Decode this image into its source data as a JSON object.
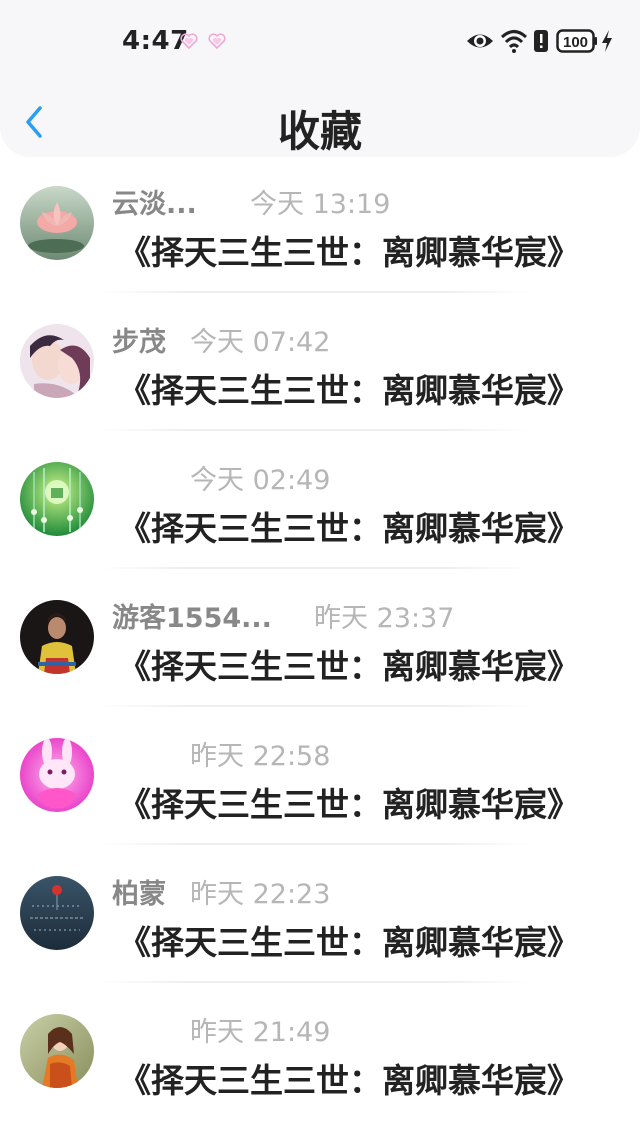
{
  "status_bar": {
    "time": "4:47",
    "battery": "100",
    "icons": [
      "heart-icon",
      "heart-icon",
      "eye-icon",
      "wifi-icon",
      "alert-icon",
      "battery-icon",
      "charging-bolt-icon"
    ]
  },
  "nav": {
    "back_icon": "chevron-left-icon",
    "title": "收藏"
  },
  "colors": {
    "accent": "#2a9df4",
    "title": "#222222",
    "name": "#888888",
    "timestamp": "#b6b6b6"
  },
  "favorites": [
    {
      "name": "云淡...",
      "time": "今天 13:19",
      "content": "《择天三生三世：离卿慕华宸》",
      "avatar": "lotus-avatar"
    },
    {
      "name": "步茂",
      "time": "今天 07:42",
      "content": "《择天三生三世：离卿慕华宸》",
      "avatar": "couple-avatar"
    },
    {
      "name": "",
      "time": "今天 02:49",
      "content": "《择天三生三世：离卿慕华宸》",
      "avatar": "green-crystal-avatar"
    },
    {
      "name": "游客1554...",
      "time": "昨天 23:37",
      "content": "《择天三生三世：离卿慕华宸》",
      "avatar": "person-avatar"
    },
    {
      "name": "",
      "time": "昨天 22:58",
      "content": "《择天三生三世：离卿慕华宸》",
      "avatar": "pink-bunny-avatar"
    },
    {
      "name": "柏蒙",
      "time": "昨天 22:23",
      "content": "《择天三生三世：离卿慕华宸》",
      "avatar": "rain-flower-avatar"
    },
    {
      "name": "",
      "time": "昨天 21:49",
      "content": "《择天三生三世：离卿慕华宸》",
      "avatar": "girl-portrait-avatar"
    }
  ]
}
